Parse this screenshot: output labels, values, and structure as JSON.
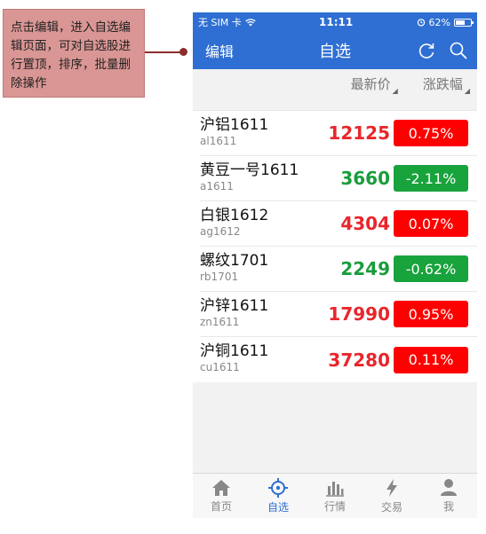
{
  "callout": {
    "text": "点击编辑，进入自选编辑页面，可对自选股进行置顶，排序，批量删除操作"
  },
  "status_bar": {
    "carrier": "无 SIM 卡",
    "time": "11:11",
    "battery": "62%",
    "battery_level": 0.62
  },
  "nav": {
    "edit_label": "编辑",
    "title": "自选",
    "refresh_icon": "refresh-icon",
    "search_icon": "search-icon"
  },
  "columns": {
    "latest_price": "最新价",
    "change_pct": "涨跌幅"
  },
  "colors": {
    "brand": "#2f6fd3",
    "up": "#e8262b",
    "down": "#1a9c3c",
    "up_badge": "#ff0000",
    "down_badge": "#18a33c"
  },
  "rows": [
    {
      "name": "沪铝1611",
      "code": "al1611",
      "price": "12125",
      "change": "0.75%",
      "direction": "up"
    },
    {
      "name": "黄豆一号1611",
      "code": "a1611",
      "price": "3660",
      "change": "-2.11%",
      "direction": "down"
    },
    {
      "name": "白银1612",
      "code": "ag1612",
      "price": "4304",
      "change": "0.07%",
      "direction": "up"
    },
    {
      "name": "螺纹1701",
      "code": "rb1701",
      "price": "2249",
      "change": "-0.62%",
      "direction": "down"
    },
    {
      "name": "沪锌1611",
      "code": "zn1611",
      "price": "17990",
      "change": "0.95%",
      "direction": "up"
    },
    {
      "name": "沪铜1611",
      "code": "cu1611",
      "price": "37280",
      "change": "0.11%",
      "direction": "up"
    }
  ],
  "tabs": [
    {
      "label": "首页",
      "icon": "home-icon",
      "active": false
    },
    {
      "label": "自选",
      "icon": "crosshair-icon",
      "active": true
    },
    {
      "label": "行情",
      "icon": "bar-chart-icon",
      "active": false
    },
    {
      "label": "交易",
      "icon": "lightning-icon",
      "active": false
    },
    {
      "label": "我",
      "icon": "person-icon",
      "active": false
    }
  ]
}
